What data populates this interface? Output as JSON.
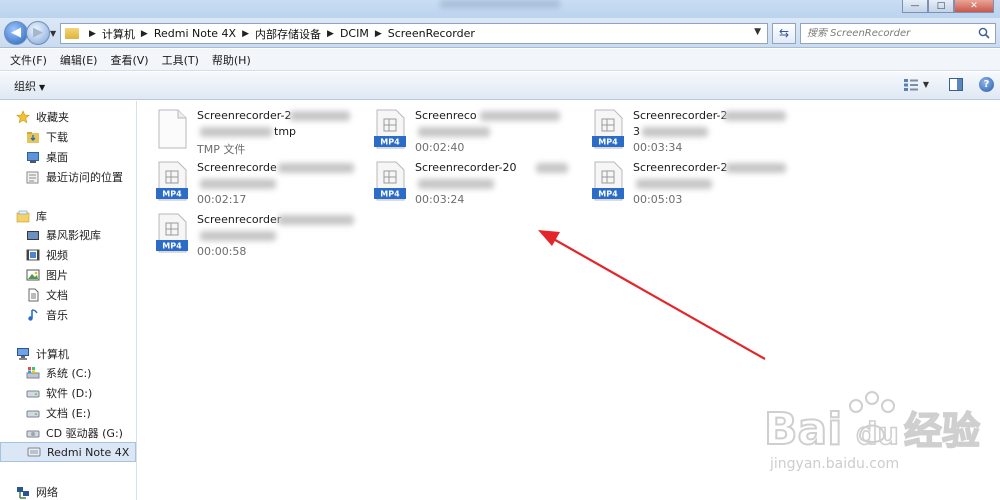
{
  "window": {
    "min": "—",
    "max": "□",
    "close": "✕"
  },
  "address": {
    "crumbs": [
      "计算机",
      "Redmi Note 4X",
      "内部存储设备",
      "DCIM",
      "ScreenRecorder"
    ]
  },
  "search": {
    "placeholder": "搜索 ScreenRecorder"
  },
  "menu": [
    "文件(F)",
    "编辑(E)",
    "查看(V)",
    "工具(T)",
    "帮助(H)"
  ],
  "toolbar": {
    "organize": "组织"
  },
  "sidebar": {
    "favorites": {
      "label": "收藏夹",
      "items": [
        "下载",
        "桌面",
        "最近访问的位置"
      ]
    },
    "libraries": {
      "label": "库",
      "items": [
        "暴风影视库",
        "视频",
        "图片",
        "文档",
        "音乐"
      ]
    },
    "computer": {
      "label": "计算机",
      "items": [
        "系统 (C:)",
        "软件 (D:)",
        "文档 (E:)",
        "CD 驱动器 (G:)",
        "Redmi Note 4X"
      ]
    },
    "network": {
      "label": "网络"
    }
  },
  "files": [
    {
      "name": "Screenrecorder-2",
      "name2": "tmp",
      "meta": "TMP 文件",
      "type": "tmp"
    },
    {
      "name": "Screenreco",
      "name2": "",
      "meta": "00:02:40",
      "type": "mp4",
      "badge": "MP4"
    },
    {
      "name": "Screenrecorder-2",
      "name2": "3",
      "meta": "00:03:34",
      "type": "mp4",
      "badge": "MP4"
    },
    {
      "name": "Screenrecorde",
      "name2": "",
      "meta": "00:02:17",
      "type": "mp4",
      "badge": "MP4"
    },
    {
      "name": "Screenrecorder-20",
      "name2": "",
      "meta": "00:03:24",
      "type": "mp4",
      "badge": "MP4"
    },
    {
      "name": "Screenrecorder-2",
      "name2": "",
      "meta": "00:05:03",
      "type": "mp4",
      "badge": "MP4"
    },
    {
      "name": "Screenrecorder",
      "name2": "",
      "meta": "00:00:58",
      "type": "mp4",
      "badge": "MP4"
    }
  ],
  "watermark": {
    "brand": "Bai du 经验",
    "url": "jingyan.baidu.com"
  },
  "colors": {
    "accent": "#2a6cc8",
    "arrow": "#e3262b",
    "mp4_badge": "#2a6cc8"
  }
}
